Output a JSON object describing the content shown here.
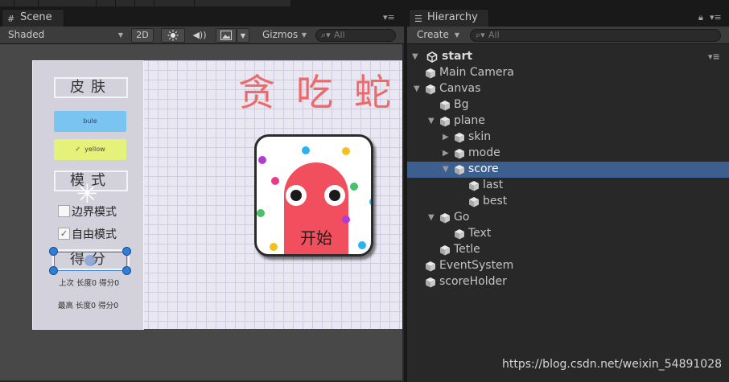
{
  "scene_panel": {
    "tab_label": "Scene",
    "tab_icon": "hash-grid-icon",
    "shading_mode": "Shaded",
    "mode_2d_label": "2D",
    "gizmos_label": "Gizmos",
    "search_placeholder": "All"
  },
  "game_ui": {
    "skin_label": "皮肤",
    "blue_button_label": "bule",
    "yellow_button_label": "yellow",
    "yellow_check": "✓",
    "mode_label": "模式",
    "border_mode_label": "边界模式",
    "free_mode_label": "自由模式",
    "free_mode_check": "✓",
    "score_label": "得分",
    "last_score": "上次 长度0 得分0",
    "best_score": "最高 长度0 得分0",
    "game_title": "贪吃蛇",
    "start_label": "开始",
    "colors": {
      "title_red": "#ee6a6a",
      "snake_red": "#f24f5e",
      "button_blue": "#79c4f1",
      "button_yellow": "#e5f27a"
    }
  },
  "hierarchy_panel": {
    "tab_label": "Hierarchy",
    "create_label": "Create",
    "search_placeholder": "All",
    "scene_name": "start",
    "items": [
      {
        "label": "Main Camera",
        "expanded": null,
        "selected": false
      },
      {
        "label": "Canvas",
        "expanded": true,
        "selected": false
      },
      {
        "label": "Bg",
        "expanded": null,
        "selected": false
      },
      {
        "label": "plane",
        "expanded": true,
        "selected": false
      },
      {
        "label": "skin",
        "expanded": false,
        "selected": false
      },
      {
        "label": "mode",
        "expanded": false,
        "selected": false
      },
      {
        "label": "score",
        "expanded": true,
        "selected": true
      },
      {
        "label": "last",
        "expanded": null,
        "selected": false
      },
      {
        "label": "best",
        "expanded": null,
        "selected": false
      },
      {
        "label": "Go",
        "expanded": true,
        "selected": false
      },
      {
        "label": "Text",
        "expanded": null,
        "selected": false
      },
      {
        "label": "Tetle",
        "expanded": null,
        "selected": false
      },
      {
        "label": "EventSystem",
        "expanded": null,
        "selected": false
      },
      {
        "label": "scoreHolder",
        "expanded": null,
        "selected": false
      }
    ],
    "selection_color": "#3d5f8f"
  },
  "watermark": "https://blog.csdn.net/weixin_54891028"
}
